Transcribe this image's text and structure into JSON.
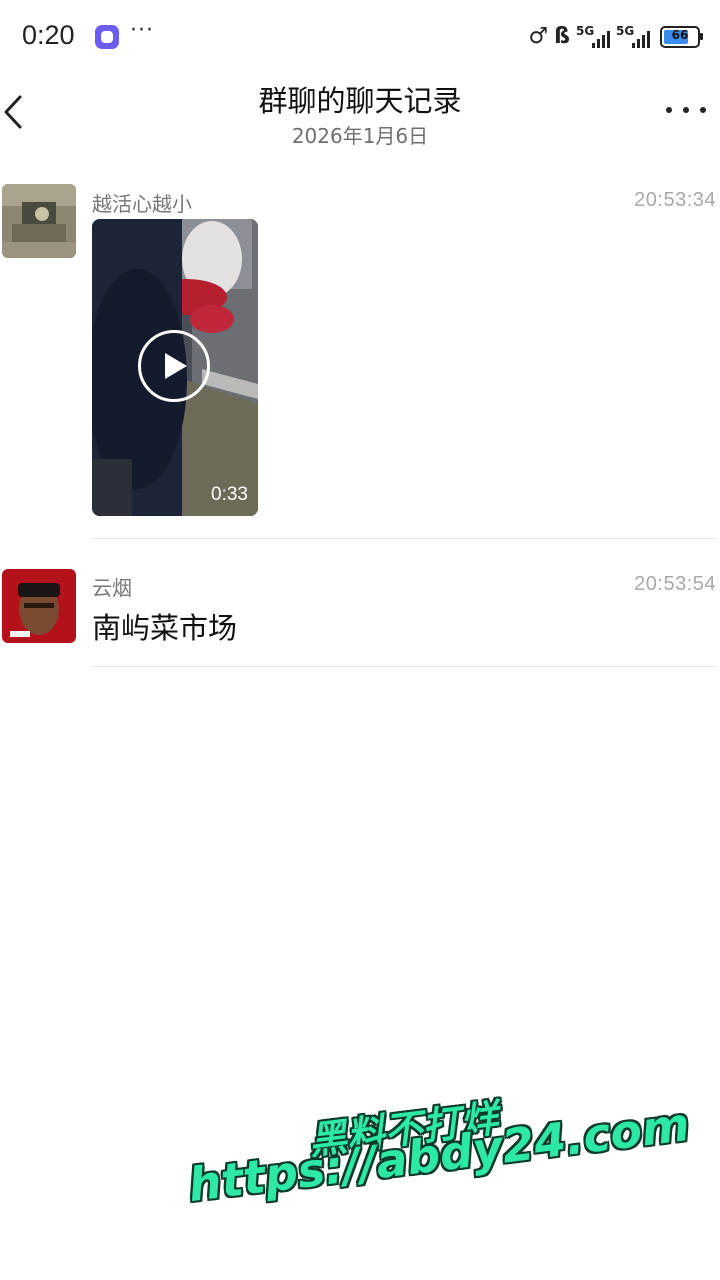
{
  "status_bar": {
    "time": "0:20",
    "more": "···",
    "icons": [
      "notification-app-icon",
      "location-icon",
      "bluetooth-icon",
      "signal-5g-icon",
      "signal-5g-icon",
      "battery-icon"
    ],
    "network_1": "5G",
    "network_2": "5G",
    "battery_level": "66"
  },
  "header": {
    "title": "群聊的聊天记录",
    "subtitle": "2026年1月6日",
    "back_icon": "chevron-left-icon",
    "more_icon": "more-dots-icon"
  },
  "messages": [
    {
      "sender": "越活心越小",
      "time": "20:53:34",
      "type": "video",
      "video_duration": "0:33",
      "play_icon": "play-icon"
    },
    {
      "sender": "云烟",
      "time": "20:53:54",
      "type": "text",
      "text": "南屿菜市场"
    }
  ],
  "watermark": {
    "line1": "黑料不打烊",
    "line2": "https://abdy24.com"
  },
  "colors": {
    "background": "#ffffff",
    "watermark": "#2ee8a6",
    "battery": "#3c8cf0"
  }
}
